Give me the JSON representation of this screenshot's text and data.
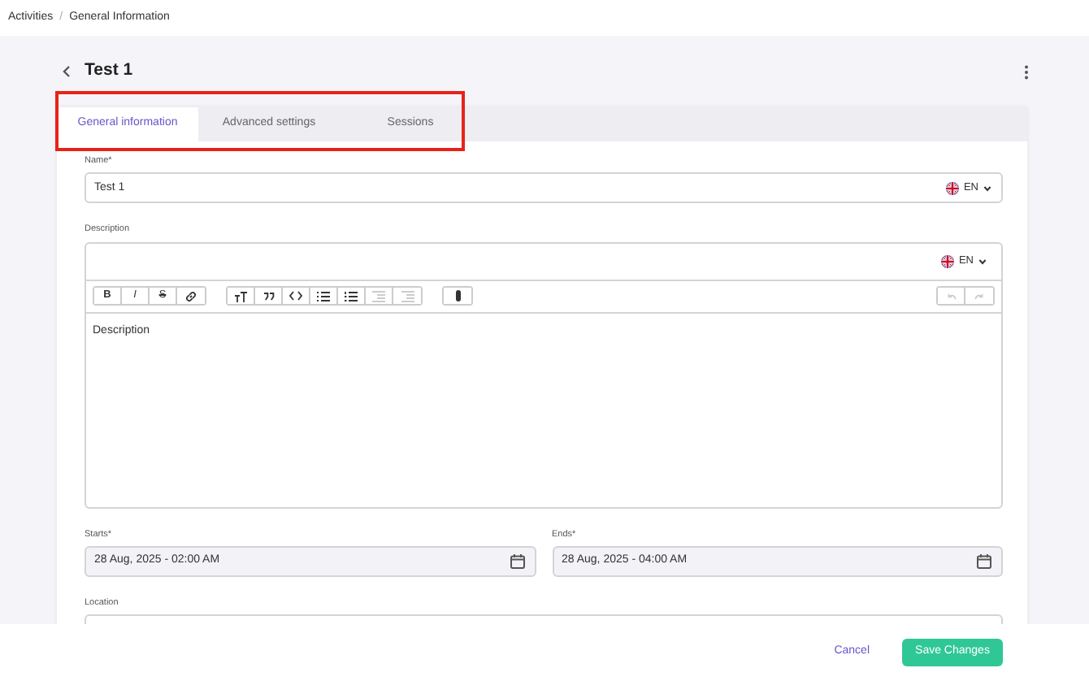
{
  "breadcrumb": {
    "items": [
      "Activities",
      "General Information"
    ],
    "separator": "/"
  },
  "page": {
    "title": "Test 1"
  },
  "tabs": [
    {
      "label": "General information",
      "selected": true
    },
    {
      "label": "Advanced settings",
      "selected": false
    },
    {
      "label": "Sessions",
      "selected": false
    }
  ],
  "name_field": {
    "label": "Name*",
    "value": "Test 1",
    "language": "EN"
  },
  "description": {
    "label": "Description",
    "language": "EN",
    "placeholder": "Description",
    "toolbar": [
      [
        {
          "label": "B",
          "disabled": false
        },
        {
          "label": "I",
          "disabled": false
        },
        {
          "label": "S",
          "disabled": false
        },
        {
          "disabled": false
        }
      ],
      [
        {
          "disabled": false
        },
        {
          "disabled": false
        },
        {
          "disabled": false
        },
        {
          "disabled": false
        },
        {
          "disabled": false
        },
        {
          "disabled": true
        },
        {
          "disabled": true
        }
      ],
      [
        {
          "disabled": false
        }
      ]
    ],
    "history": [
      {
        "disabled": true
      },
      {
        "disabled": true
      }
    ]
  },
  "starts": {
    "label": "Starts*",
    "value": "28 Aug, 2025 - 02:00 AM"
  },
  "ends": {
    "label": "Ends*",
    "value": "28 Aug, 2025 - 04:00 AM"
  },
  "location": {
    "label": "Location"
  },
  "footer": {
    "cancel": "Cancel",
    "save": "Save Changes"
  }
}
